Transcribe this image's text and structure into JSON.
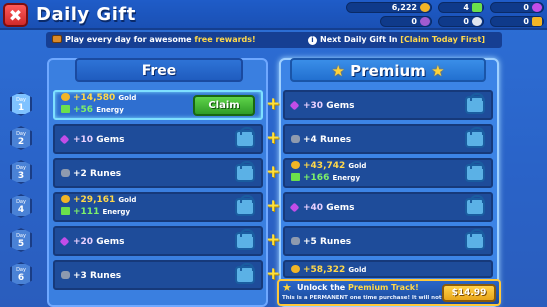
{
  "header": {
    "close_symbol": "✖",
    "title": "Daily Gift",
    "resources": [
      {
        "name": "gold",
        "value": "6,222",
        "color": "#f2b526"
      },
      {
        "name": "energy",
        "value": "4",
        "color": "#6be04c"
      },
      {
        "name": "gems",
        "value": "0",
        "color": "#c24de8"
      },
      {
        "name": "item-a",
        "value": "0",
        "color": "#a05bd0"
      },
      {
        "name": "item-b",
        "value": "0",
        "color": "#e0e6f0"
      },
      {
        "name": "item-c",
        "value": "0",
        "color": "#f2b526"
      }
    ]
  },
  "info_bar": {
    "left_prefix": "Play every day for awesome ",
    "left_highlight": "free rewards!",
    "right_prefix": "Next Daily Gift In ",
    "right_highlight": "[Claim Today First]"
  },
  "tracks": {
    "free_title": "Free",
    "premium_title": "Premium",
    "star_symbol": "★",
    "plus_symbol": "+"
  },
  "days": [
    {
      "label": "Day",
      "number": "1"
    },
    {
      "label": "Day",
      "number": "2"
    },
    {
      "label": "Day",
      "number": "3"
    },
    {
      "label": "Day",
      "number": "4"
    },
    {
      "label": "Day",
      "number": "5"
    },
    {
      "label": "Day",
      "number": "6"
    }
  ],
  "free_rewards": [
    {
      "line1_value": "+14,580",
      "line1_unit": "Gold",
      "line2_value": "+56",
      "line2_unit": "Energy",
      "action": "Claim"
    },
    {
      "line1_value": "+10",
      "line1_unit": "Gems"
    },
    {
      "line1_value": "+2",
      "line1_unit": "Runes"
    },
    {
      "line1_value": "+29,161",
      "line1_unit": "Gold",
      "line2_value": "+111",
      "line2_unit": "Energy"
    },
    {
      "line1_value": "+20",
      "line1_unit": "Gems"
    },
    {
      "line1_value": "+3",
      "line1_unit": "Runes"
    }
  ],
  "premium_rewards": [
    {
      "line1_value": "+30",
      "line1_unit": "Gems"
    },
    {
      "line1_value": "+4",
      "line1_unit": "Runes"
    },
    {
      "line1_value": "+43,742",
      "line1_unit": "Gold",
      "line2_value": "+166",
      "line2_unit": "Energy"
    },
    {
      "line1_value": "+40",
      "line1_unit": "Gems"
    },
    {
      "line1_value": "+5",
      "line1_unit": "Runes"
    },
    {
      "line1_value": "+58,322",
      "line1_unit": "Gold"
    }
  ],
  "unlock": {
    "title_prefix": "Unlock the ",
    "title_highlight": "Premium Track!",
    "subtitle": "This is a PERMANENT one time purchase! It will not reset!",
    "price": "$14.99"
  }
}
